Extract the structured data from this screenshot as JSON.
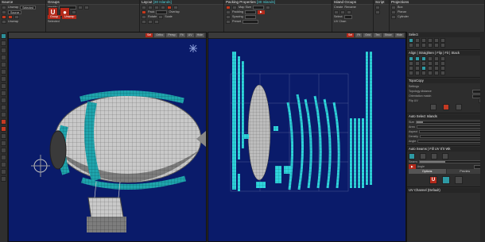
{
  "ribbon": {
    "panels": [
      {
        "id": "source",
        "title": "Source",
        "rows": [
          "Unwrap",
          "Selected",
          "Source",
          "Unwrap"
        ]
      },
      {
        "id": "groups",
        "title": "Groups",
        "rows": [
          "Identity",
          "Selected",
          "Group",
          "Unwrap"
        ]
      },
      {
        "id": "layout",
        "title": "Layout",
        "title_hl": "[30 Islands]",
        "rows": [
          "Pack",
          "Overlap",
          "Rotate",
          "Scale"
        ]
      },
      {
        "id": "packing",
        "title": "Packing Properties",
        "title_hl": "[30 Islands]",
        "rows": [
          "Map Size",
          "Padding",
          "Spacing",
          "Preset"
        ]
      },
      {
        "id": "island_groups",
        "title": "Island Groups",
        "rows": [
          "Create",
          "Rename",
          "Select",
          "UV Chan"
        ]
      },
      {
        "id": "script",
        "title": "Script",
        "rows": [
          "Run",
          "Edit"
        ]
      },
      {
        "id": "projections",
        "title": "Projections",
        "rows": [
          "Box",
          "Planar",
          "Cylinder"
        ]
      }
    ]
  },
  "viewport_3d": {
    "buttons": [
      "Sel",
      "Ortho",
      "Persp",
      "Fit",
      "UV",
      "Hide"
    ]
  },
  "viewport_uv": {
    "buttons": [
      "Sel",
      "Fit",
      "Grid",
      "Tex",
      "Show",
      "Hide"
    ]
  },
  "right_panel": {
    "header": "Select",
    "align_title": "Align | Straighten | Flip | Fit | Stack",
    "topo_title": "TopoCopy",
    "topo_rows": [
      "Settings",
      "Topology distance",
      "Orientation match",
      "Flip UV"
    ],
    "auto_title": "Auto Select Islands",
    "auto_rows": [
      "Size",
      "Area",
      "Aspect",
      "Density",
      "Angle"
    ],
    "auto_seams_title": "Auto Seams | Fill UV 0ʼ0 Wk",
    "auto_seams_rows": [
      "Seams",
      "Angle",
      "Options",
      "Preview"
    ],
    "uv_channel_title": "UV Channel (Default)"
  },
  "colors": {
    "uv_cyan": "#2fd4dc",
    "viewport_bg": "#0a1b6a",
    "accent_red": "#b3291a"
  }
}
